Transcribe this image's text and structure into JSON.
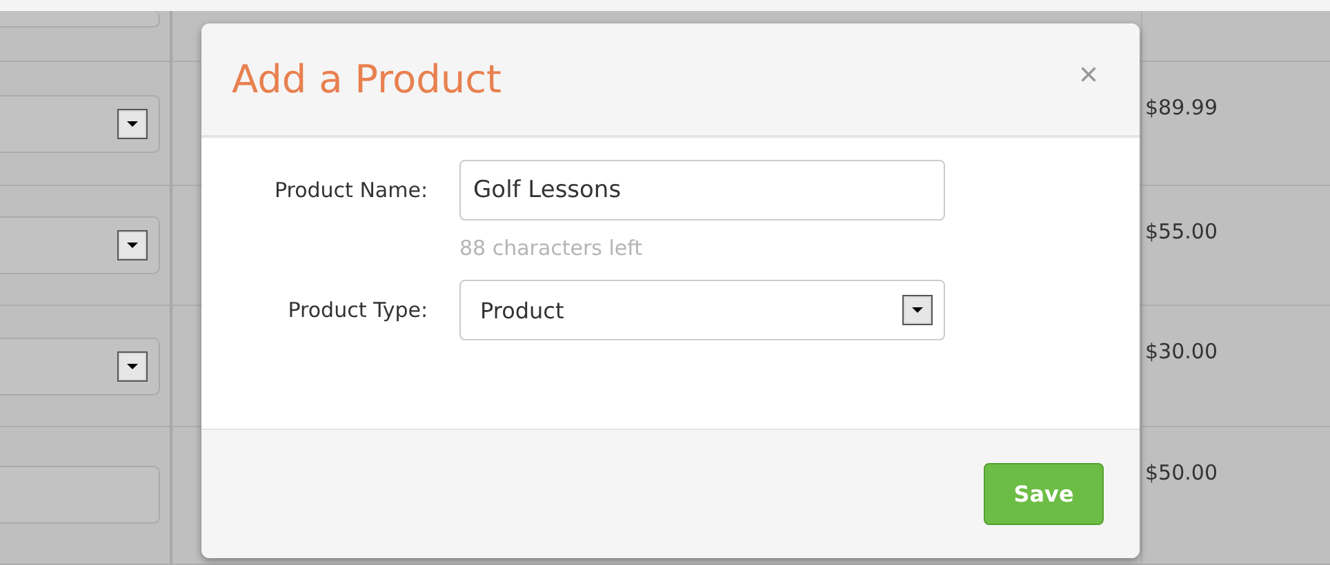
{
  "table": {
    "rows": [
      {
        "kind": "field"
      },
      {
        "kind": "select",
        "price": "$89.99"
      },
      {
        "kind": "select",
        "price": "$55.00"
      },
      {
        "kind": "select",
        "price": "$30.00"
      },
      {
        "kind": "field",
        "price": "$50.00"
      }
    ]
  },
  "dialog": {
    "title": "Add a Product",
    "close": "×",
    "fields": [
      {
        "kind": "text",
        "label": "Product Name:",
        "value": "Golf Lessons",
        "hint": "88 characters left"
      },
      {
        "kind": "select",
        "label": "Product Type:",
        "value": "Product"
      }
    ],
    "buttons": [
      {
        "label": "Save"
      }
    ]
  }
}
